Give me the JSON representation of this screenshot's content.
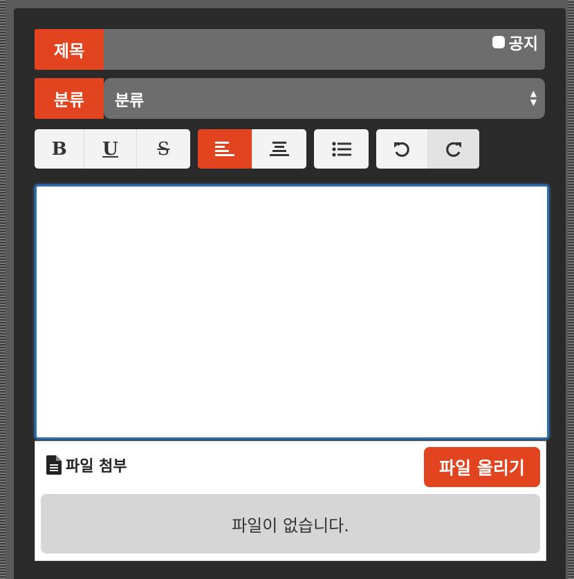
{
  "form": {
    "title_label": "제목",
    "title_value": "",
    "notice_label": "공지",
    "notice_checked": false,
    "category_label": "분류",
    "category_selected": "분류"
  },
  "toolbar": {
    "bold_label": "B",
    "underline_label": "U",
    "strike_label": "S",
    "buttons": [
      "bold",
      "underline",
      "strikethrough",
      "align-left",
      "align-center",
      "bulleted-list",
      "undo",
      "redo"
    ],
    "active": "align-left"
  },
  "attachment": {
    "title": "파일 첨부",
    "upload_label": "파일 올리기",
    "empty_message": "파일이 없습니다."
  },
  "colors": {
    "accent": "#e2441f",
    "panel": "#2a2a2a",
    "field": "#6d6d6d",
    "focus": "#2e6fb0"
  }
}
